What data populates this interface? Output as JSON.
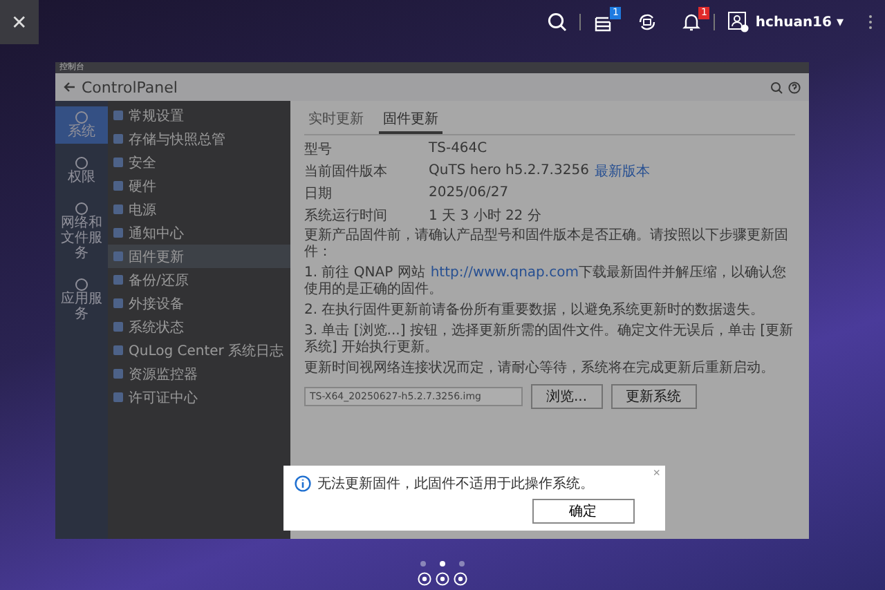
{
  "topbar": {
    "close": "✕",
    "task_badge": "1",
    "notification_badge": "1",
    "user": "hchuan16",
    "caret": "▾"
  },
  "window": {
    "title": "控制台",
    "app_name": "ControlPanel"
  },
  "nav": [
    {
      "label": "系统",
      "selected": true
    },
    {
      "label": "权限",
      "selected": false
    },
    {
      "label": "网络和文件服务",
      "selected": false
    },
    {
      "label": "应用服务",
      "selected": false
    }
  ],
  "menu": [
    {
      "label": "常规设置",
      "selected": false
    },
    {
      "label": "存储与快照总管",
      "selected": false
    },
    {
      "label": "安全",
      "selected": false
    },
    {
      "label": "硬件",
      "selected": false
    },
    {
      "label": "电源",
      "selected": false
    },
    {
      "label": "通知中心",
      "selected": false
    },
    {
      "label": "固件更新",
      "selected": true
    },
    {
      "label": "备份/还原",
      "selected": false
    },
    {
      "label": "外接设备",
      "selected": false
    },
    {
      "label": "系统状态",
      "selected": false
    },
    {
      "label": "QuLog Center 系统日志",
      "selected": false
    },
    {
      "label": "资源监控器",
      "selected": false
    },
    {
      "label": "许可证中心",
      "selected": false
    }
  ],
  "tabs": [
    {
      "label": "实时更新",
      "selected": false
    },
    {
      "label": "固件更新",
      "selected": true
    }
  ],
  "info": [
    {
      "label": "型号",
      "value": "TS-464C"
    },
    {
      "label": "当前固件版本",
      "value": "QuTS hero h5.2.7.3256",
      "link": "最新版本"
    },
    {
      "label": "日期",
      "value": "2025/06/27"
    },
    {
      "label": "系统运行时间",
      "value": "1 天 3 小时 22 分"
    }
  ],
  "intro": "更新产品固件前，请确认产品型号和固件版本是否正确。请按照以下步骤更新固件：",
  "steps": [
    {
      "before": "1. 前往 QNAP 网站",
      "link": "http://www.qnap.com",
      "after": "下载最新固件并解压缩，以确认您使用的是正确的固件。"
    },
    {
      "before": "2. 在执行固件更新前请备份所有重要数据，以避免系统更新时的数据遗失。"
    },
    {
      "before": "3. 单击 [浏览...] 按钮，选择更新所需的固件文件。确定文件无误后，单击 [更新系统] 开始执行更新。"
    }
  ],
  "note": "更新时间视网络连接状况而定，请耐心等待，系统将在完成更新后重新启动。",
  "file_field": {
    "value": "TS-X64_20250627-h5.2.7.3256.img"
  },
  "buttons": [
    "浏览...",
    "更新系统"
  ],
  "dialog": {
    "close": "×",
    "message": "无法更新固件，此固件不适用于此操作系统。",
    "button": "确定"
  },
  "pages": [
    {
      "selected": false
    },
    {
      "selected": true
    },
    {
      "selected": false
    }
  ]
}
